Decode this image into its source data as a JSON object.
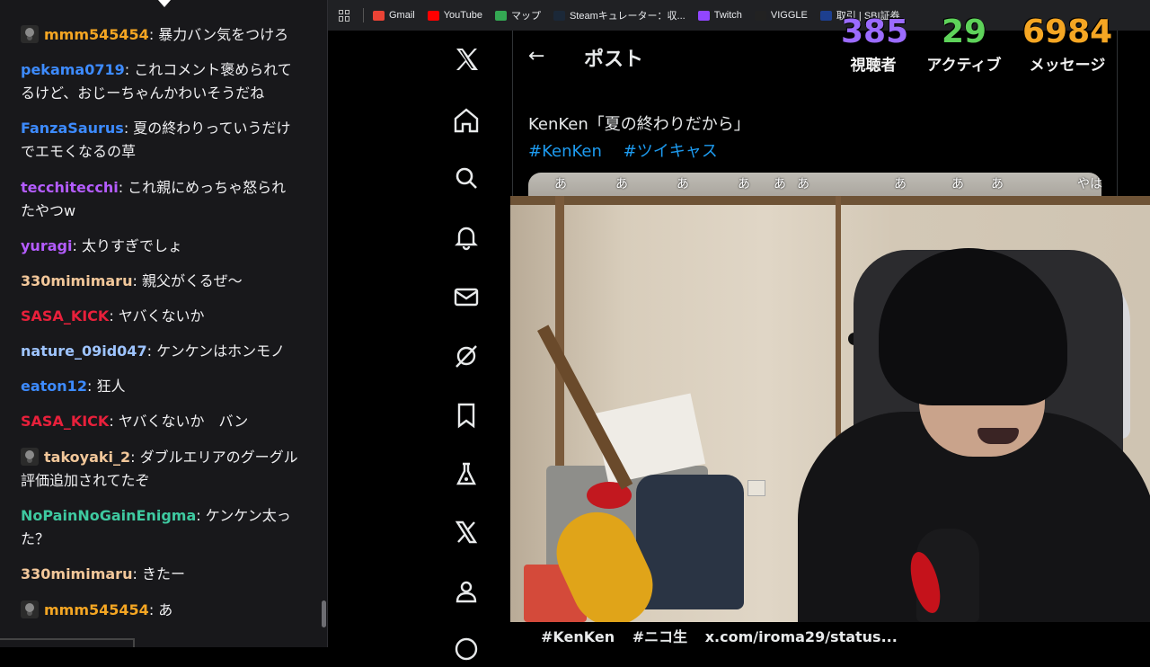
{
  "chat": {
    "messages": [
      {
        "user": "mmm545454",
        "color": "#f5a623",
        "badge": true,
        "text": "暴力バン気をつけろ"
      },
      {
        "user": "pekama0719",
        "color": "#3d8bff",
        "badge": false,
        "text": "これコメント褒められてるけど、おじーちゃんかわいそうだね"
      },
      {
        "user": "FanzaSaurus",
        "color": "#3d8bff",
        "badge": false,
        "text": "夏の終わりっていうだけでエモくなるの草"
      },
      {
        "user": "tecchitecchi",
        "color": "#b45cff",
        "badge": false,
        "text": "これ親にめっちゃ怒られたやつw"
      },
      {
        "user": "yuragi",
        "color": "#b45cff",
        "badge": false,
        "text": "太りすぎでしょ"
      },
      {
        "user": "330mimimaru",
        "color": "#f2c79a",
        "badge": false,
        "text": "親父がくるぜ〜"
      },
      {
        "user": "SASA_KICK",
        "color": "#e8203b",
        "badge": false,
        "text": "ヤバくないか"
      },
      {
        "user": "nature_09id047",
        "color": "#9ec4ff",
        "badge": false,
        "text": "ケンケンはホンモノ"
      },
      {
        "user": "eaton12",
        "color": "#3d8bff",
        "badge": false,
        "text": "狂人"
      },
      {
        "user": "SASA_KICK",
        "color": "#e8203b",
        "badge": false,
        "text": "ヤバくないか　バン"
      },
      {
        "user": "takoyaki_2",
        "color": "#f2c79a",
        "badge": true,
        "text": "ダブルエリアのグーグル評価追加されてたぞ"
      },
      {
        "user": "NoPainNoGainEnigma",
        "color": "#3ec9a0",
        "badge": false,
        "text": "ケンケン太った？"
      },
      {
        "user": "330mimimaru",
        "color": "#f2c79a",
        "badge": false,
        "text": "きたー"
      },
      {
        "user": "mmm545454",
        "color": "#f5a623",
        "badge": true,
        "text": "あ"
      }
    ]
  },
  "bookmarks": [
    {
      "label": "Gmail",
      "icon": "gmail-icon",
      "color": "#ea4335"
    },
    {
      "label": "YouTube",
      "icon": "youtube-icon",
      "color": "#ff0000"
    },
    {
      "label": "マップ",
      "icon": "maps-icon",
      "color": "#34a853"
    },
    {
      "label": "Steamキュレーター：収...",
      "icon": "steam-icon",
      "color": "#1b2838"
    },
    {
      "label": "Twitch",
      "icon": "twitch-icon",
      "color": "#9146ff"
    },
    {
      "label": "VIGGLE",
      "icon": "viggle-icon",
      "color": "#222222"
    },
    {
      "label": "取引 | SBI証券",
      "icon": "sbi-icon",
      "color": "#1d3f8f"
    }
  ],
  "x": {
    "page_title": "ポスト",
    "post_text": "KenKen「夏の終わりだから」",
    "hashtags": [
      "#KenKen",
      "#ツイキャス"
    ],
    "danmaku": [
      "あ",
      "あ",
      "あ",
      "あ",
      "あ",
      "あ",
      "あ",
      "あ",
      "あ",
      "やは"
    ]
  },
  "stats": [
    {
      "value": "385",
      "label": "視聴者",
      "color": "#9b6bff"
    },
    {
      "value": "29",
      "label": "アクティブ",
      "color": "#5ed35a"
    },
    {
      "value": "6984",
      "label": "メッセージ",
      "color": "#f5a623"
    }
  ],
  "ticker": {
    "items": [
      "#KenKen",
      "#ニコ生",
      "x.com/iroma29/status..."
    ]
  }
}
